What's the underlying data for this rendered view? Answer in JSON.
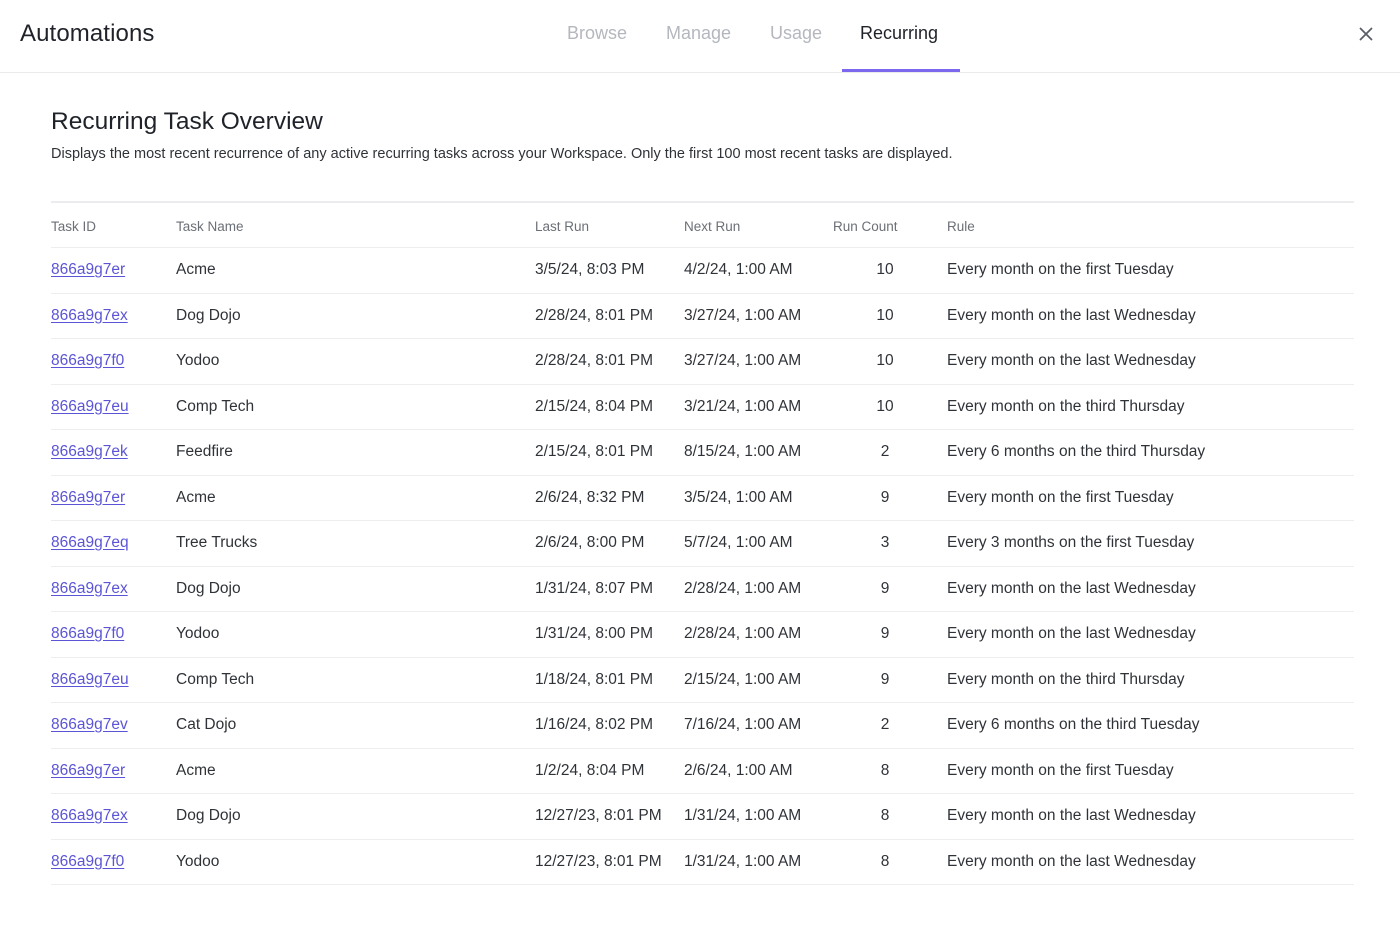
{
  "header": {
    "title": "Automations",
    "tabs": [
      {
        "label": "Browse",
        "active": false
      },
      {
        "label": "Manage",
        "active": false
      },
      {
        "label": "Usage",
        "active": false
      },
      {
        "label": "Recurring",
        "active": true
      }
    ],
    "close_icon": "close-icon",
    "accent_color": "#7b68ee"
  },
  "main": {
    "title": "Recurring Task Overview",
    "description": "Displays the most recent recurrence of any active recurring tasks across your Workspace. Only the first 100 most recent tasks are displayed."
  },
  "table": {
    "columns": [
      "Task ID",
      "Task Name",
      "Last Run",
      "Next Run",
      "Run Count",
      "Rule"
    ],
    "link_color": "#5b54d6",
    "rows": [
      {
        "task_id": "866a9g7er",
        "task_name": "Acme",
        "last_run": "3/5/24, 8:03 PM",
        "next_run": "4/2/24, 1:00 AM",
        "run_count": "10",
        "rule": "Every month on the first Tuesday"
      },
      {
        "task_id": "866a9g7ex",
        "task_name": "Dog Dojo",
        "last_run": "2/28/24, 8:01 PM",
        "next_run": "3/27/24, 1:00 AM",
        "run_count": "10",
        "rule": "Every month on the last Wednesday"
      },
      {
        "task_id": "866a9g7f0",
        "task_name": "Yodoo",
        "last_run": "2/28/24, 8:01 PM",
        "next_run": "3/27/24, 1:00 AM",
        "run_count": "10",
        "rule": "Every month on the last Wednesday"
      },
      {
        "task_id": "866a9g7eu",
        "task_name": "Comp Tech",
        "last_run": "2/15/24, 8:04 PM",
        "next_run": "3/21/24, 1:00 AM",
        "run_count": "10",
        "rule": "Every month on the third Thursday"
      },
      {
        "task_id": "866a9g7ek",
        "task_name": "Feedfire",
        "last_run": "2/15/24, 8:01 PM",
        "next_run": "8/15/24, 1:00 AM",
        "run_count": "2",
        "rule": "Every 6 months on the third Thursday"
      },
      {
        "task_id": "866a9g7er",
        "task_name": "Acme",
        "last_run": "2/6/24, 8:32 PM",
        "next_run": "3/5/24, 1:00 AM",
        "run_count": "9",
        "rule": "Every month on the first Tuesday"
      },
      {
        "task_id": "866a9g7eq",
        "task_name": "Tree Trucks",
        "last_run": "2/6/24, 8:00 PM",
        "next_run": "5/7/24, 1:00 AM",
        "run_count": "3",
        "rule": "Every 3 months on the first Tuesday"
      },
      {
        "task_id": "866a9g7ex",
        "task_name": "Dog Dojo",
        "last_run": "1/31/24, 8:07 PM",
        "next_run": "2/28/24, 1:00 AM",
        "run_count": "9",
        "rule": "Every month on the last Wednesday"
      },
      {
        "task_id": "866a9g7f0",
        "task_name": "Yodoo",
        "last_run": "1/31/24, 8:00 PM",
        "next_run": "2/28/24, 1:00 AM",
        "run_count": "9",
        "rule": "Every month on the last Wednesday"
      },
      {
        "task_id": "866a9g7eu",
        "task_name": "Comp Tech",
        "last_run": "1/18/24, 8:01 PM",
        "next_run": "2/15/24, 1:00 AM",
        "run_count": "9",
        "rule": "Every month on the third Thursday"
      },
      {
        "task_id": "866a9g7ev",
        "task_name": "Cat Dojo",
        "last_run": "1/16/24, 8:02 PM",
        "next_run": "7/16/24, 1:00 AM",
        "run_count": "2",
        "rule": "Every 6 months on the third Tuesday"
      },
      {
        "task_id": "866a9g7er",
        "task_name": "Acme",
        "last_run": "1/2/24, 8:04 PM",
        "next_run": "2/6/24, 1:00 AM",
        "run_count": "8",
        "rule": "Every month on the first Tuesday"
      },
      {
        "task_id": "866a9g7ex",
        "task_name": "Dog Dojo",
        "last_run": "12/27/23, 8:01 PM",
        "next_run": "1/31/24, 1:00 AM",
        "run_count": "8",
        "rule": "Every month on the last Wednesday"
      },
      {
        "task_id": "866a9g7f0",
        "task_name": "Yodoo",
        "last_run": "12/27/23, 8:01 PM",
        "next_run": "1/31/24, 1:00 AM",
        "run_count": "8",
        "rule": "Every month on the last Wednesday"
      }
    ]
  }
}
